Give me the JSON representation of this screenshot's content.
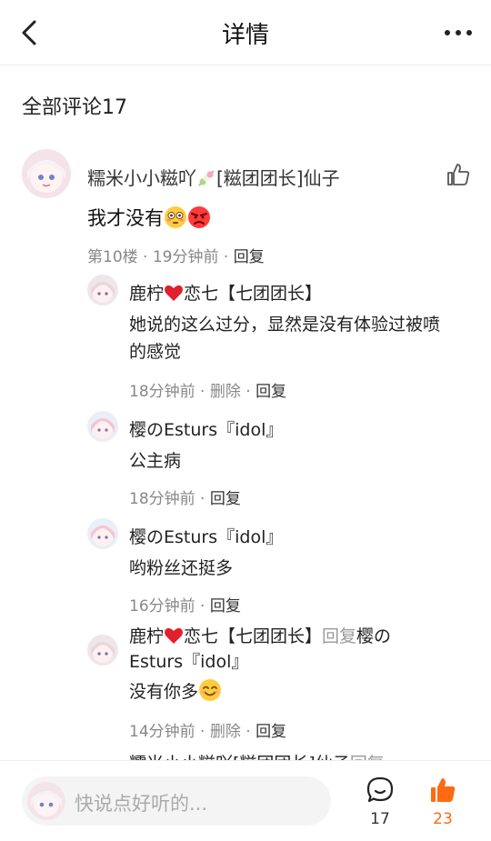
{
  "header": {
    "title": "详情"
  },
  "section": {
    "title": "全部评论17"
  },
  "comment": {
    "author": "糯米小小糍吖",
    "author_badge": "[糍团团长]仙子",
    "text": "我才没有",
    "meta_floor": "第10楼 · 19分钟前 · ",
    "reply_label": "回复"
  },
  "replies": [
    {
      "author_before_heart": "鹿柠",
      "author_after_heart": "恋七【七团团长】",
      "text": " 她说的这么过分，显然是没有体验过被喷的感觉",
      "time": "18分钟前 · ",
      "delete_label": "删除",
      "sep": " · ",
      "reply_label": "回复"
    },
    {
      "author": "樱のEsturs『idol』",
      "text": "公主病",
      "time": "18分钟前 · ",
      "reply_label": "回复"
    },
    {
      "author": "樱のEsturs『idol』",
      "text": "哟粉丝还挺多",
      "time": "16分钟前 · ",
      "reply_label": "回复"
    },
    {
      "author_before_heart": "鹿柠",
      "author_after_heart": "恋七【七团团长】",
      "reply_word": "回复",
      "target_line1": "樱の",
      "target_line2": "Esturs『idol』",
      "text": "没有你多",
      "time": "14分钟前 · ",
      "delete_label": "删除",
      "sep": " · ",
      "reply_label": "回复"
    }
  ],
  "cut_off_line": {
    "text": "糯米小小糍吖",
    "badge": "[糍团团长]仙子",
    "reply_word": "回复"
  },
  "bottom_bar": {
    "input_placeholder": "快说点好听的...",
    "comment_count": "17",
    "like_count": "23"
  },
  "colors": {
    "accent": "#ff6a13",
    "meta": "#888888",
    "reply_grey": "#999999"
  },
  "icons": [
    "back-icon",
    "more-icon",
    "thumb-up-outline-icon",
    "comment-bubble-icon",
    "thumb-up-filled-icon",
    "heart-icon",
    "flushed-face-emoji",
    "angry-face-emoji",
    "smile-emoji",
    "dango-icon"
  ]
}
